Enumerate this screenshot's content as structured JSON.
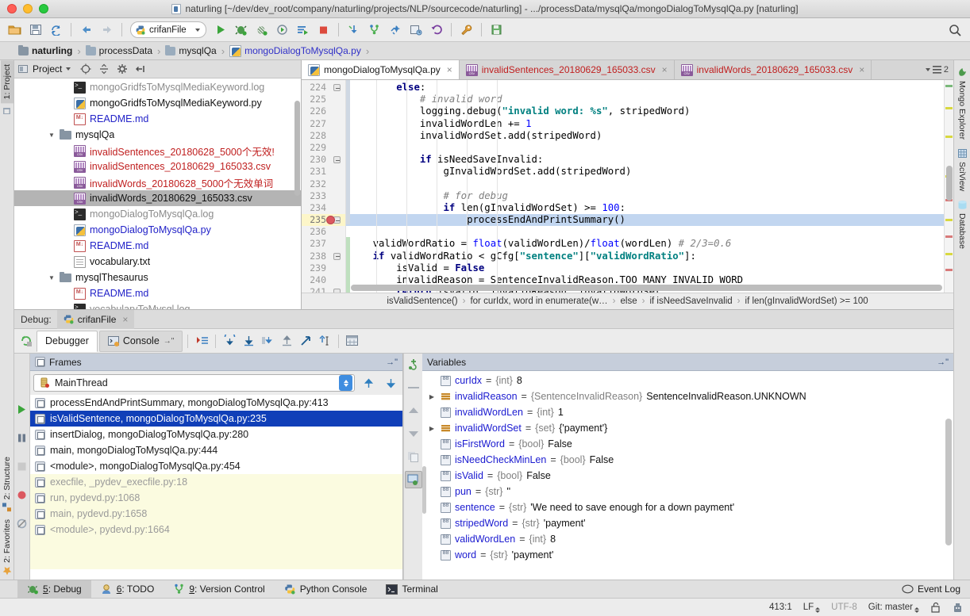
{
  "window": {
    "title": "naturling [~/dev/dev_root/company/naturling/projects/NLP/sourcecode/naturling] - .../processData/mysqlQa/mongoDialogToMysqlQa.py [naturling]"
  },
  "toolbar": {
    "run_config": "crifanFile",
    "icons": [
      "open-folder-icon",
      "save-all-icon",
      "sync-icon",
      "back-icon",
      "forward-icon",
      "run-icon",
      "debug-icon",
      "coverage-icon",
      "profile-icon",
      "run-with-console-icon",
      "stop-icon",
      "update-project-icon",
      "vcs-branch-icon",
      "vcs-commit-icon",
      "vcs-history-icon",
      "revert-icon",
      "settings-wrench-icon",
      "save-snapshot-icon"
    ]
  },
  "breadcrumb": {
    "items": [
      {
        "label": "naturling",
        "icon": "folder-icon",
        "style": "bold"
      },
      {
        "label": "processData",
        "icon": "folder-icon",
        "style": "normal"
      },
      {
        "label": "mysqlQa",
        "icon": "folder-icon",
        "style": "normal"
      },
      {
        "label": "mongoDialogToMysqlQa.py",
        "icon": "python-file-icon",
        "style": "blue"
      }
    ],
    "separator": "›"
  },
  "left_strip": {
    "top": [
      {
        "label": "1: Project",
        "active": true
      }
    ],
    "bottom": [
      {
        "label": "2: Structure"
      },
      {
        "label": "2: Favorites"
      }
    ]
  },
  "right_strip": {
    "items": [
      {
        "label": "Mongo Explorer",
        "icon": "leaf-icon"
      },
      {
        "label": "SciView",
        "icon": "grid-icon"
      },
      {
        "label": "Database",
        "icon": "database-icon"
      }
    ]
  },
  "project_panel": {
    "title": "Project",
    "caret": "▾",
    "header_icons": [
      "locate-icon",
      "collapse-all-icon",
      "gear-icon",
      "hide-icon"
    ],
    "tree": [
      {
        "indent": 3,
        "icon": "log-file-icon",
        "label": "mongoGridfsToMysqlMediaKeyword.log",
        "color": "grey",
        "twist": "",
        "selected": false
      },
      {
        "indent": 3,
        "icon": "python-file-icon",
        "label": "mongoGridfsToMysqlMediaKeyword.py",
        "color": "black",
        "twist": "",
        "selected": false
      },
      {
        "indent": 3,
        "icon": "markdown-file-icon",
        "label": "README.md",
        "color": "blue",
        "twist": "",
        "selected": false
      },
      {
        "indent": 2,
        "icon": "folder-icon",
        "label": "mysqlQa",
        "color": "black",
        "twist": "▼",
        "selected": false
      },
      {
        "indent": 3,
        "icon": "csv-file-icon",
        "label": "invalidSentences_20180628_5000个无效!",
        "color": "red",
        "twist": "",
        "selected": false
      },
      {
        "indent": 3,
        "icon": "csv-file-icon",
        "label": "invalidSentences_20180629_165033.csv",
        "color": "red",
        "twist": "",
        "selected": false
      },
      {
        "indent": 3,
        "icon": "csv-file-icon",
        "label": "invalidWords_20180628_5000个无效单词",
        "color": "red",
        "twist": "",
        "selected": false
      },
      {
        "indent": 3,
        "icon": "csv-file-icon",
        "label": "invalidWords_20180629_165033.csv",
        "color": "black",
        "twist": "",
        "selected": true
      },
      {
        "indent": 3,
        "icon": "log-file-icon",
        "label": "mongoDialogToMysqlQa.log",
        "color": "grey",
        "twist": "",
        "selected": false
      },
      {
        "indent": 3,
        "icon": "python-file-icon",
        "label": "mongoDialogToMysqlQa.py",
        "color": "blue",
        "twist": "",
        "selected": false
      },
      {
        "indent": 3,
        "icon": "markdown-file-icon",
        "label": "README.md",
        "color": "blue",
        "twist": "",
        "selected": false
      },
      {
        "indent": 3,
        "icon": "text-file-icon",
        "label": "vocabulary.txt",
        "color": "black",
        "twist": "",
        "selected": false
      },
      {
        "indent": 2,
        "icon": "folder-icon",
        "label": "mysqlThesaurus",
        "color": "black",
        "twist": "▼",
        "selected": false
      },
      {
        "indent": 3,
        "icon": "markdown-file-icon",
        "label": "README.md",
        "color": "blue",
        "twist": "",
        "selected": false
      },
      {
        "indent": 3,
        "icon": "log-file-icon",
        "label": "vocabularyToMysql.log",
        "color": "grey",
        "twist": "",
        "selected": false
      }
    ]
  },
  "editor": {
    "tabs": [
      {
        "label": "mongoDialogToMysqlQa.py",
        "icon": "python-file-icon",
        "active": true,
        "color": "black"
      },
      {
        "label": "invalidSentences_20180629_165033.csv",
        "icon": "csv-file-icon",
        "active": false,
        "color": "red"
      },
      {
        "label": "invalidWords_20180629_165033.csv",
        "icon": "csv-file-icon",
        "active": false,
        "color": "red"
      }
    ],
    "tab_overflow_count": "2",
    "close_glyph": "×",
    "first_line": 224,
    "breakpoint_line": 235,
    "highlight_line": 235,
    "lines": [
      {
        "no": 224,
        "tokens": [
          {
            "t": "        ",
            "c": "plain"
          },
          {
            "t": "else",
            "c": "k"
          },
          {
            "t": ":",
            "c": "plain"
          }
        ],
        "fold": true
      },
      {
        "no": 225,
        "tokens": [
          {
            "t": "            # invalid word",
            "c": "c"
          }
        ]
      },
      {
        "no": 226,
        "tokens": [
          {
            "t": "            logging.debug(",
            "c": "plain"
          },
          {
            "t": "\"invalid word: %s\"",
            "c": "s"
          },
          {
            "t": ", stripedWord)",
            "c": "plain"
          }
        ]
      },
      {
        "no": 227,
        "tokens": [
          {
            "t": "            invalidWordLen += ",
            "c": "plain"
          },
          {
            "t": "1",
            "c": "n"
          }
        ]
      },
      {
        "no": 228,
        "tokens": [
          {
            "t": "            invalidWordSet.add(stripedWord)",
            "c": "plain"
          }
        ]
      },
      {
        "no": 229,
        "tokens": [
          {
            "t": "",
            "c": "plain"
          }
        ]
      },
      {
        "no": 230,
        "tokens": [
          {
            "t": "            ",
            "c": "plain"
          },
          {
            "t": "if",
            "c": "k"
          },
          {
            "t": " isNeedSaveInvalid:",
            "c": "plain"
          }
        ],
        "fold": true
      },
      {
        "no": 231,
        "tokens": [
          {
            "t": "                gInvalidWordSet.add(stripedWord)",
            "c": "plain"
          }
        ]
      },
      {
        "no": 232,
        "tokens": [
          {
            "t": "",
            "c": "plain"
          }
        ]
      },
      {
        "no": 233,
        "tokens": [
          {
            "t": "                # for debug",
            "c": "c"
          }
        ]
      },
      {
        "no": 234,
        "tokens": [
          {
            "t": "                ",
            "c": "plain"
          },
          {
            "t": "if",
            "c": "k"
          },
          {
            "t": " len(gInvalidWordSet) >= ",
            "c": "plain"
          },
          {
            "t": "100",
            "c": "n"
          },
          {
            "t": ":",
            "c": "plain"
          }
        ]
      },
      {
        "no": 235,
        "tokens": [
          {
            "t": "                    processEndAndPrintSummary()",
            "c": "plain"
          }
        ],
        "highlight": true,
        "fold": true
      },
      {
        "no": 236,
        "tokens": [
          {
            "t": "",
            "c": "plain"
          }
        ]
      },
      {
        "no": 237,
        "tokens": [
          {
            "t": "    validWordRatio = ",
            "c": "plain"
          },
          {
            "t": "float",
            "c": "n"
          },
          {
            "t": "(validWordLen)/",
            "c": "plain"
          },
          {
            "t": "float",
            "c": "n"
          },
          {
            "t": "(wordLen) ",
            "c": "plain"
          },
          {
            "t": "# 2/3=0.6",
            "c": "c"
          }
        ]
      },
      {
        "no": 238,
        "tokens": [
          {
            "t": "    ",
            "c": "plain"
          },
          {
            "t": "if",
            "c": "k"
          },
          {
            "t": " validWordRatio < gCfg[",
            "c": "plain"
          },
          {
            "t": "\"sentence\"",
            "c": "s"
          },
          {
            "t": "][",
            "c": "plain"
          },
          {
            "t": "\"validWordRatio\"",
            "c": "s"
          },
          {
            "t": "]:",
            "c": "plain"
          }
        ],
        "fold": true
      },
      {
        "no": 239,
        "tokens": [
          {
            "t": "        isValid = ",
            "c": "plain"
          },
          {
            "t": "False",
            "c": "k"
          }
        ]
      },
      {
        "no": 240,
        "tokens": [
          {
            "t": "        invalidReason = SentenceInvalidReason.TOO_MANY_INVALID_WORD",
            "c": "plain"
          }
        ]
      },
      {
        "no": 241,
        "tokens": [
          {
            "t": "        ",
            "c": "plain"
          },
          {
            "t": "return",
            "c": "k"
          },
          {
            "t": " isValid, invalidReason, invalidWordSet",
            "c": "plain"
          }
        ],
        "fold": true
      },
      {
        "no": 242,
        "tokens": [
          {
            "t": "",
            "c": "plain"
          }
        ]
      }
    ],
    "code_breadcrumb": [
      "isValidSentence()",
      "for curIdx, word in enumerate(w…",
      "else",
      "if isNeedSaveInvalid",
      "if len(gInvalidWordSet) >= 100"
    ],
    "code_breadcrumb_sep": "›"
  },
  "debug": {
    "session_label": "Debug:",
    "session_tab": "crifanFile",
    "session_close": "×",
    "rerun_icon": "rerun-icon",
    "subtabs": [
      {
        "label": "Debugger",
        "icon": "",
        "active": true
      },
      {
        "label": "Console",
        "icon": "console-icon",
        "active": false
      }
    ],
    "stepper_icons": [
      "show-execution-point-icon",
      "step-over-icon",
      "step-into-icon",
      "force-step-into-icon",
      "step-out-icon",
      "run-to-cursor-icon",
      "evaluate-expression-icon",
      "view-breakpoints-icon"
    ],
    "left_strip_icons": [
      "resume-program-icon",
      "pause-program-icon",
      "stop-icon",
      "view-breakpoints-icon",
      "mute-breakpoints-icon"
    ],
    "frames": {
      "title": "Frames",
      "thread": "MainThread",
      "thread_icon": "thread-icon",
      "nav_up_icon": "arrow-up-icon",
      "nav_down_icon": "arrow-down-icon",
      "items": [
        {
          "label": "processEndAndPrintSummary, mongoDialogToMysqlQa.py:413",
          "selected": false,
          "library": false
        },
        {
          "label": "isValidSentence, mongoDialogToMysqlQa.py:235",
          "selected": true,
          "library": false
        },
        {
          "label": "insertDialog, mongoDialogToMysqlQa.py:280",
          "selected": false,
          "library": false
        },
        {
          "label": "main, mongoDialogToMysqlQa.py:444",
          "selected": false,
          "library": false
        },
        {
          "label": "<module>, mongoDialogToMysqlQa.py:454",
          "selected": false,
          "library": false
        },
        {
          "label": "execfile, _pydev_execfile.py:18",
          "selected": false,
          "library": true
        },
        {
          "label": "run, pydevd.py:1068",
          "selected": false,
          "library": true
        },
        {
          "label": "main, pydevd.py:1658",
          "selected": false,
          "library": true
        },
        {
          "label": "<module>, pydevd.py:1664",
          "selected": false,
          "library": true
        }
      ]
    },
    "variables": {
      "title": "Variables",
      "items": [
        {
          "name": "curIdx",
          "type": "{int}",
          "value": "8",
          "expandable": false,
          "kind": "prim"
        },
        {
          "name": "invalidReason",
          "type": "{SentenceInvalidReason}",
          "value": "SentenceInvalidReason.UNKNOWN",
          "expandable": true,
          "kind": "obj"
        },
        {
          "name": "invalidWordLen",
          "type": "{int}",
          "value": "1",
          "expandable": false,
          "kind": "prim"
        },
        {
          "name": "invalidWordSet",
          "type": "{set}",
          "value": "{'payment'}",
          "expandable": true,
          "kind": "obj"
        },
        {
          "name": "isFirstWord",
          "type": "{bool}",
          "value": "False",
          "expandable": false,
          "kind": "prim"
        },
        {
          "name": "isNeedCheckMinLen",
          "type": "{bool}",
          "value": "False",
          "expandable": false,
          "kind": "prim"
        },
        {
          "name": "isValid",
          "type": "{bool}",
          "value": "False",
          "expandable": false,
          "kind": "prim"
        },
        {
          "name": "pun",
          "type": "{str}",
          "value": "''",
          "expandable": false,
          "kind": "prim"
        },
        {
          "name": "sentence",
          "type": "{str}",
          "value": "'We need to save enough for a down payment'",
          "expandable": false,
          "kind": "prim"
        },
        {
          "name": "stripedWord",
          "type": "{str}",
          "value": "'payment'",
          "expandable": false,
          "kind": "prim"
        },
        {
          "name": "validWordLen",
          "type": "{int}",
          "value": "8",
          "expandable": false,
          "kind": "prim"
        },
        {
          "name": "word",
          "type": "{str}",
          "value": "'payment'",
          "expandable": false,
          "kind": "prim"
        }
      ]
    },
    "side_icons": [
      "new-watch-icon",
      "remove-watch-icon",
      "up-icon",
      "down-icon",
      "copy-icon",
      "inspect-icon"
    ]
  },
  "toolwindow_bar": {
    "items": [
      {
        "label": "5: Debug",
        "mnemonic": "5",
        "icon": "debug-icon",
        "active": true
      },
      {
        "label": "6: TODO",
        "mnemonic": "6",
        "icon": "todo-icon",
        "active": false
      },
      {
        "label": "9: Version Control",
        "mnemonic": "9",
        "icon": "vcs-icon",
        "active": false
      },
      {
        "label": "Python Console",
        "mnemonic": "",
        "icon": "python-icon",
        "active": false
      },
      {
        "label": "Terminal",
        "mnemonic": "",
        "icon": "terminal-icon",
        "active": false
      }
    ],
    "event_log": "Event Log",
    "event_log_icon": "balloon-icon"
  },
  "statusbar": {
    "caret": "413:1",
    "line_separator": "LF",
    "encoding": "UTF-8",
    "branch": "Git: master",
    "lock_icon": "unlock-icon",
    "inspector_icon": "hector-icon"
  },
  "colors": {
    "accent_blue": "#103fb8",
    "selection_code": "#c2d6f0",
    "breakpoint_red": "#db5860",
    "link_blue": "#2222c8",
    "string_teal": "#008080",
    "keyword_navy": "#000080"
  }
}
